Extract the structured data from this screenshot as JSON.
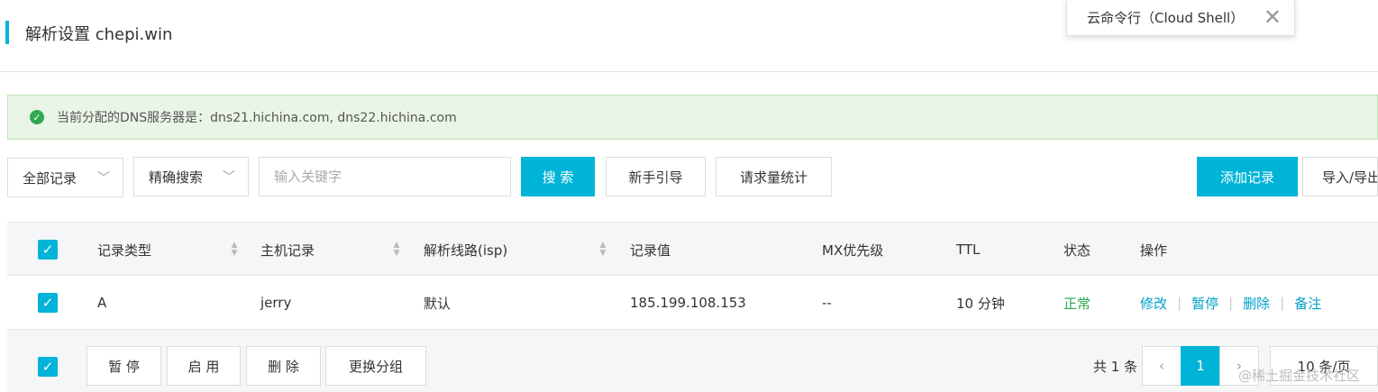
{
  "header": {
    "title": "解析设置 chepi.win"
  },
  "cloud_shell": {
    "label": "云命令行（Cloud Shell）",
    "close": "✕"
  },
  "dns_banner": {
    "text": "当前分配的DNS服务器是：dns21.hichina.com, dns22.hichina.com"
  },
  "toolbar": {
    "record_filter": "全部记录",
    "search_mode": "精确搜索",
    "search_placeholder": "输入关键字",
    "search_label": "搜 索",
    "guide_label": "新手引导",
    "stats_label": "请求量统计",
    "add_label": "添加记录",
    "import_export_label": "导入/导出"
  },
  "table": {
    "columns": [
      "记录类型",
      "主机记录",
      "解析线路(isp)",
      "记录值",
      "MX优先级",
      "TTL",
      "状态",
      "操作"
    ],
    "rows": [
      {
        "type": "A",
        "host": "jerry",
        "line": "默认",
        "value": "185.199.108.153",
        "mx": "--",
        "ttl": "10 分钟",
        "status": "正常",
        "actions": [
          "修改",
          "暂停",
          "删除",
          "备注"
        ]
      }
    ]
  },
  "footer": {
    "pause_label": "暂 停",
    "enable_label": "启 用",
    "delete_label": "删 除",
    "group_label": "更换分组",
    "total_label": "共 1 条",
    "current_page": "1",
    "page_size": "10 条/页"
  },
  "watermark": "@稀土掘金技术社区",
  "colors": {
    "accent": "#00b4d8",
    "success": "#2fa84f",
    "link": "#00a0c8"
  }
}
